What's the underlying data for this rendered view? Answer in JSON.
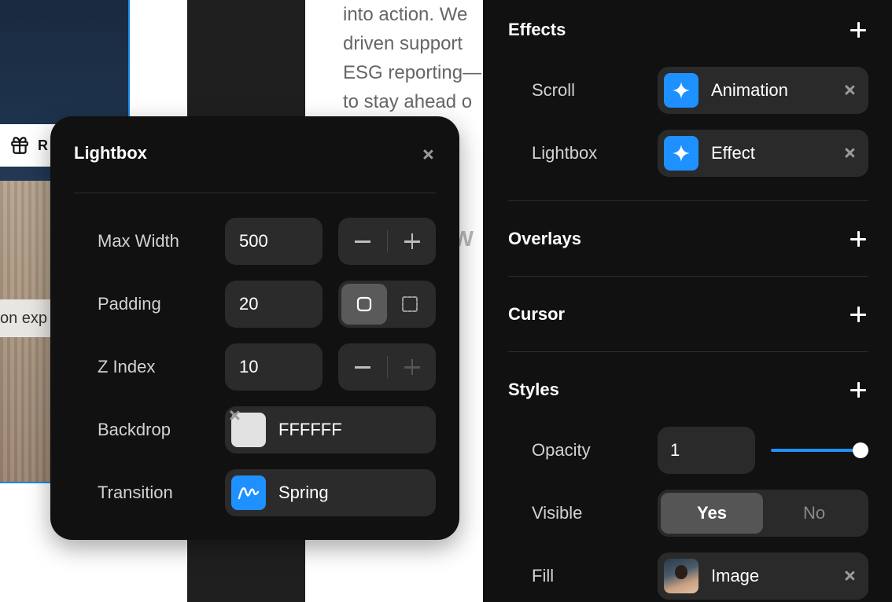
{
  "canvas": {
    "tag_letter": "R",
    "photo_caption": "on exp",
    "body_lines": [
      "into action. We",
      "driven support",
      "ESG reporting—",
      "to stay ahead o"
    ],
    "ghost_word": "aW"
  },
  "lightbox": {
    "title": "Lightbox",
    "fields": {
      "max_width": {
        "label": "Max Width",
        "value": "500"
      },
      "padding": {
        "label": "Padding",
        "value": "20"
      },
      "z_index": {
        "label": "Z Index",
        "value": "10"
      },
      "backdrop": {
        "label": "Backdrop",
        "value": "FFFFFF",
        "color": "#E2E2E2"
      },
      "transition": {
        "label": "Transition",
        "value": "Spring"
      }
    }
  },
  "panel": {
    "effects": {
      "title": "Effects",
      "rows": [
        {
          "label": "Scroll",
          "value": "Animation"
        },
        {
          "label": "Lightbox",
          "value": "Effect"
        }
      ]
    },
    "overlays": {
      "title": "Overlays"
    },
    "cursor": {
      "title": "Cursor"
    },
    "styles": {
      "title": "Styles",
      "opacity": {
        "label": "Opacity",
        "value": "1",
        "level": 1.0
      },
      "visible": {
        "label": "Visible",
        "options": [
          "Yes",
          "No"
        ],
        "selected": "Yes"
      },
      "fill": {
        "label": "Fill",
        "value": "Image"
      }
    }
  },
  "colors": {
    "accent": "#1E90FF",
    "panel_bg": "#111111",
    "field_bg": "#2A2A2A"
  }
}
